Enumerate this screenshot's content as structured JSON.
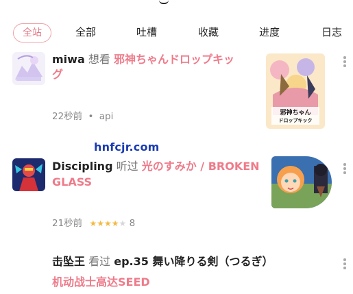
{
  "tabs": [
    {
      "label": "全站",
      "active": true
    },
    {
      "label": "全部"
    },
    {
      "label": "吐槽"
    },
    {
      "label": "收藏"
    },
    {
      "label": "进度"
    },
    {
      "label": "日志"
    }
  ],
  "feed": [
    {
      "user": "miwa",
      "verb": "想看",
      "subject_line1": "邪神ちゃんドロップキッ",
      "subject_line2": "グ",
      "time": "22秒前",
      "separator": "•",
      "source": "api",
      "cover_text": "邪神ちゃん\nドロップキック"
    },
    {
      "user": "Discipling",
      "verb": "听过",
      "subject_line1": "光のすみか / BROKEN",
      "subject_line2": "GLASS",
      "time": "21秒前",
      "rating": 4,
      "rating_max": 5,
      "rating_value": "8"
    },
    {
      "user": "击坠王",
      "verb": "看过",
      "subject_line1": "ep.35 舞い降りる剣（つるぎ）",
      "subject_line2": "机动战士高达SEED"
    }
  ],
  "watermark": "hnfcjr.com",
  "colors": {
    "accent": "#ee7b8a",
    "tab_border": "#f0a0a8",
    "star": "#f4b942"
  }
}
